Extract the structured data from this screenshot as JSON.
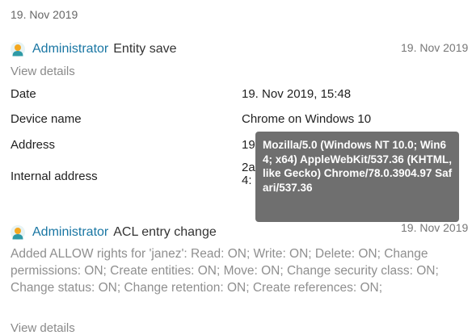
{
  "group": {
    "date": "19. Nov 2019"
  },
  "entries": [
    {
      "user": "Administrator",
      "action": "Entity save",
      "date": "19. Nov 2019",
      "view_details": "View details",
      "details": [
        {
          "label": "Date",
          "value": "19. Nov 2019, 15:48"
        },
        {
          "label": "Device name",
          "value": "Chrome on Windows 10"
        },
        {
          "label": "Address",
          "value": "19"
        },
        {
          "label": "Internal address",
          "value": "2a",
          "value2": "4:"
        }
      ]
    },
    {
      "user": "Administrator",
      "action": "ACL entry change",
      "date": "19. Nov 2019",
      "description": "Added ALLOW rights for 'janez': Read: ON; Write: ON; Delete: ON; Change permissions: ON; Create entities: ON; Move: ON; Change security class: ON; Change status: ON; Change retention: ON; Create references: ON;",
      "view_details": "View details"
    }
  ],
  "tooltip": {
    "text": "Mozilla/5.0 (Windows NT 10.0; Win64; x64) AppleWebKit/537.36 (KHTML, like Gecko) Chrome/78.0.3904.97 Safari/537.36"
  },
  "icons": {
    "avatar": "user-avatar-icon"
  },
  "colors": {
    "link": "#1976a3",
    "tooltip_bg": "#6f6f6f",
    "muted": "#8a8a8a",
    "avatar_head": "#f4a820",
    "avatar_body": "#2e9aa6"
  }
}
